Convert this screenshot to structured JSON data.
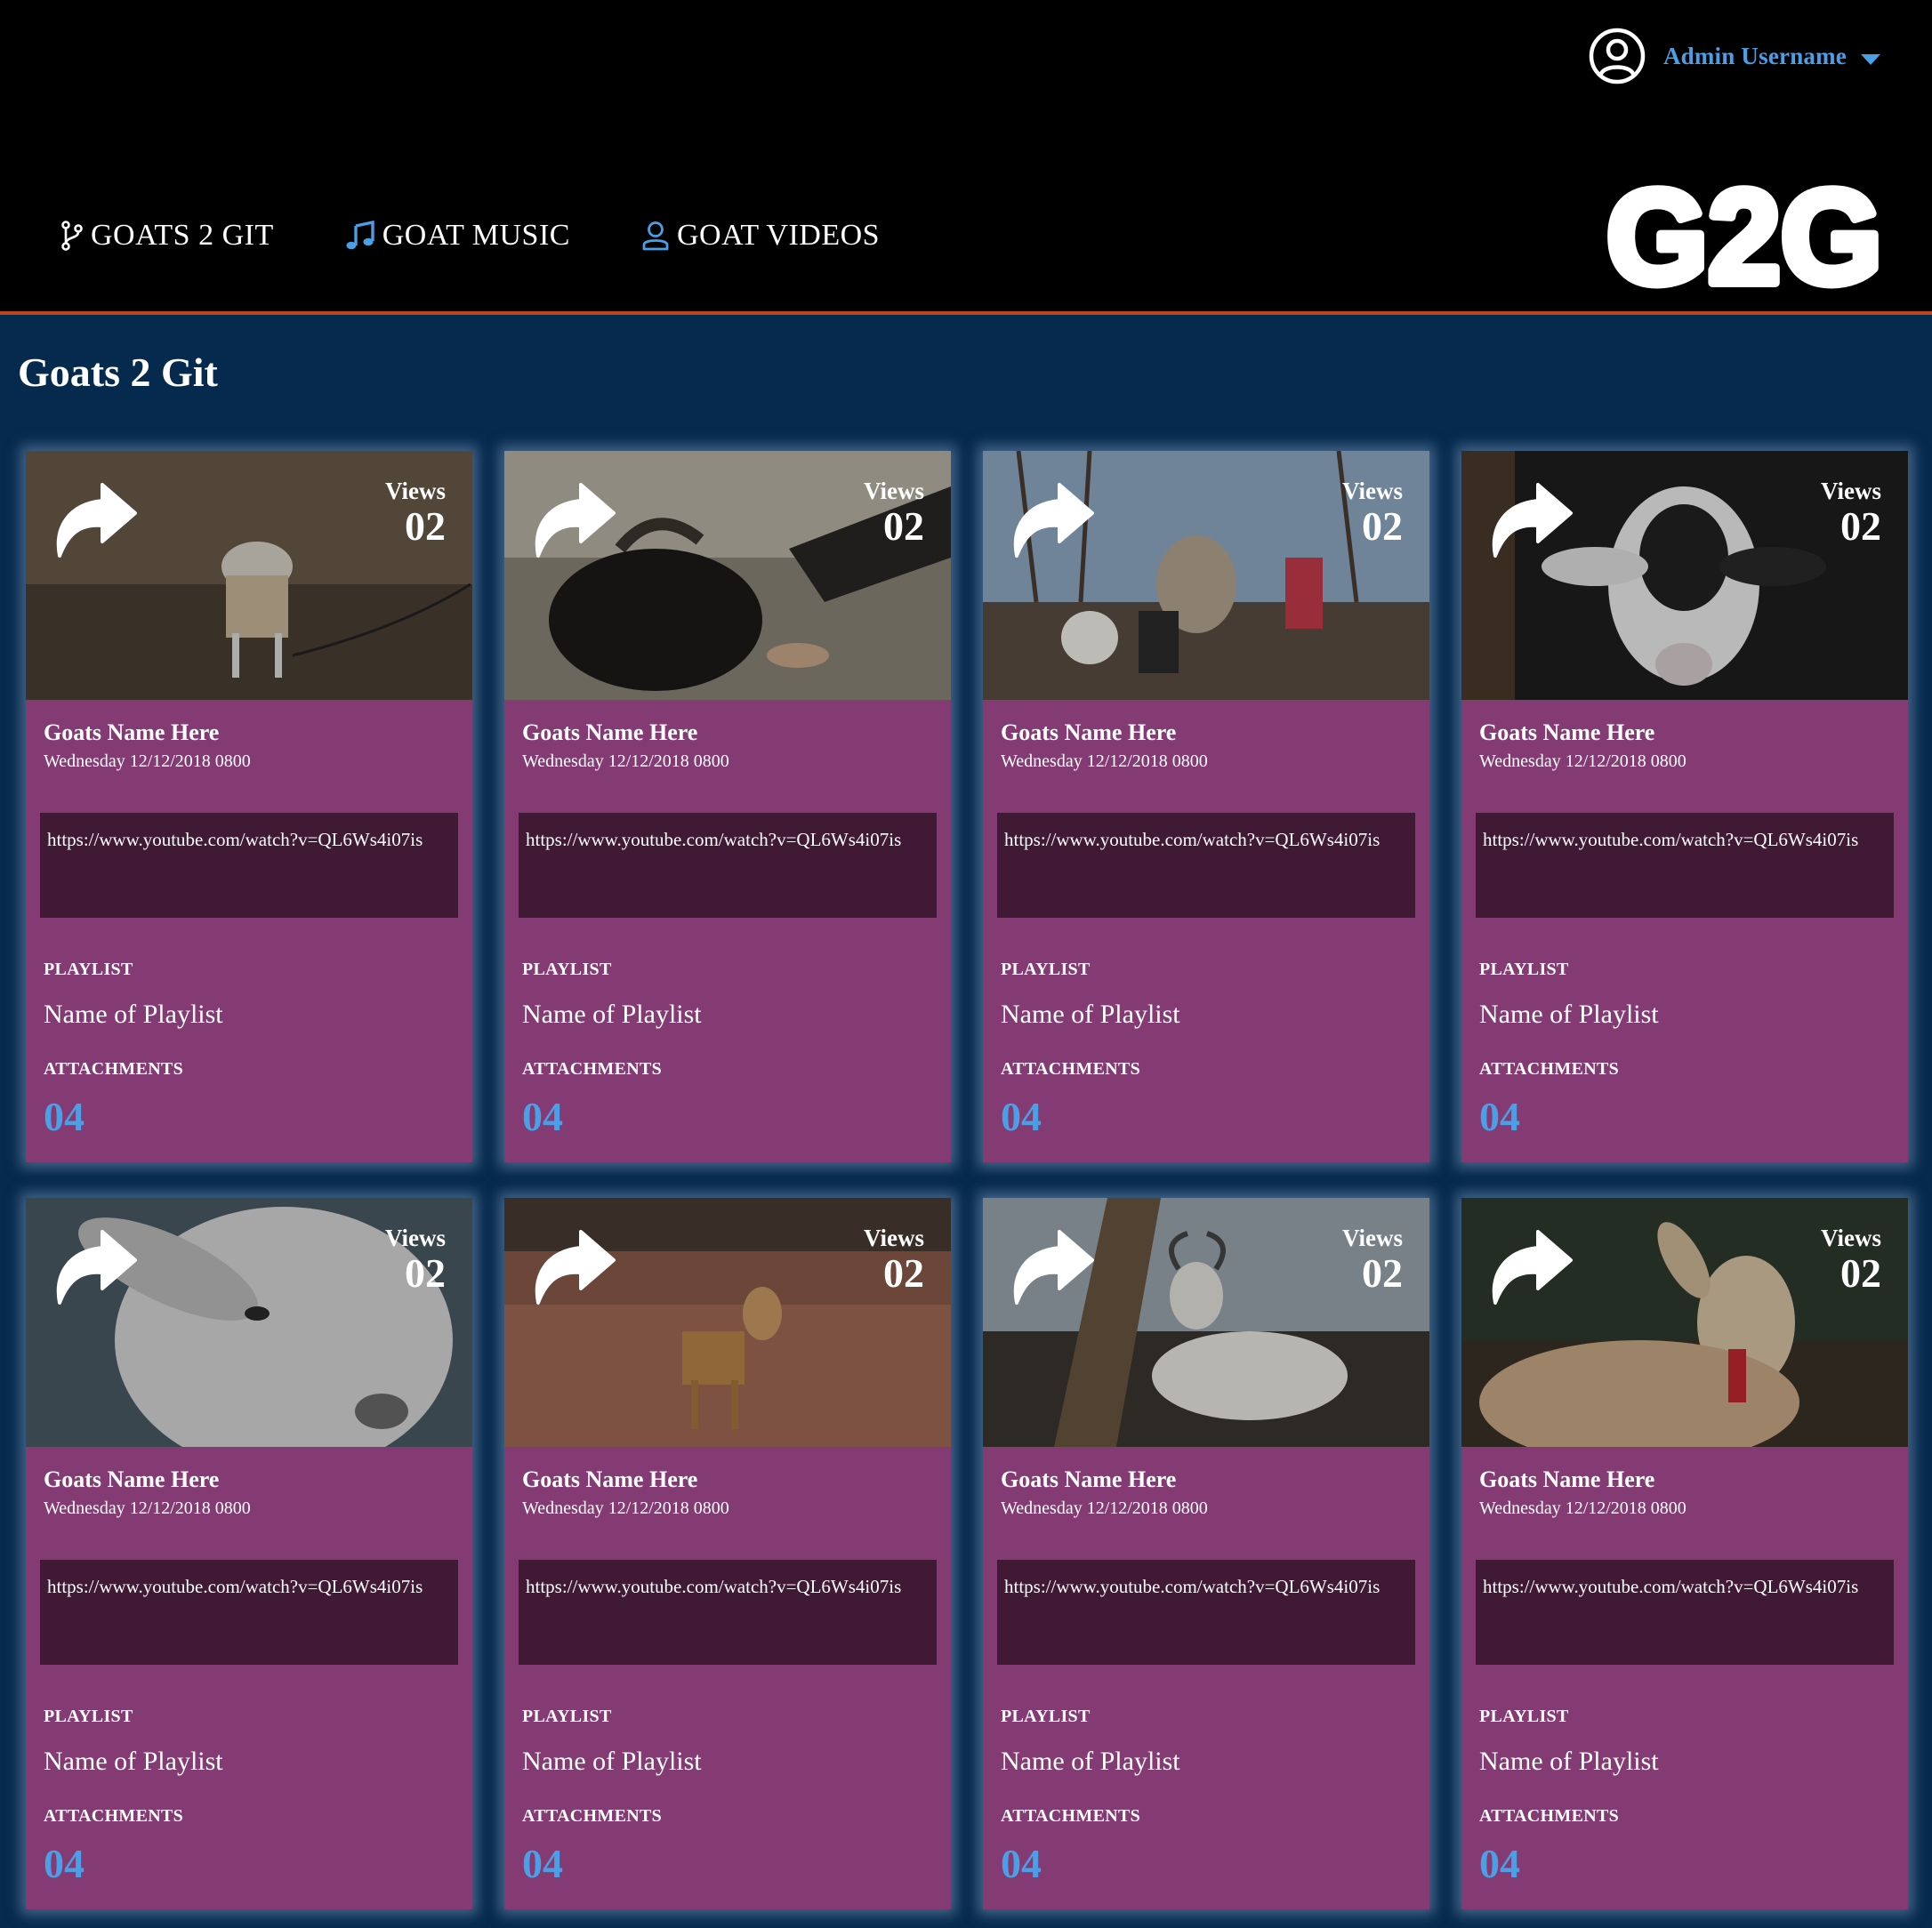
{
  "header": {
    "user": {
      "name": "Admin Username",
      "avatar_icon": "user-circle-icon",
      "menu_icon": "caret-down-icon"
    },
    "nav": [
      {
        "label": "GOATS 2 GIT",
        "icon": "git-branch-icon"
      },
      {
        "label": "GOAT MUSIC",
        "icon": "music-note-icon"
      },
      {
        "label": "GOAT VIDEOS",
        "icon": "user-outline-icon"
      }
    ],
    "logo_text": "G2G"
  },
  "page": {
    "title": "Goats 2 Git"
  },
  "colors": {
    "header_bg": "#000000",
    "page_bg": "#062a4d",
    "header_border": "#c0441f",
    "card_bg": "#843a73",
    "url_box_bg": "#401935",
    "accent_blue": "#4a9fe6"
  },
  "cards": [
    {
      "views_label": "Views",
      "views": "02",
      "name": "Goats Name Here",
      "date": "Wednesday 12/12/2018 0800",
      "url": "https://www.youtube.com/watch?v=QL6Ws4i07is",
      "playlist_label": "PLAYLIST",
      "playlist": "Name of Playlist",
      "attachments_label": "ATTACHMENTS",
      "attachments": "04",
      "share_icon": "share-arrow-icon"
    },
    {
      "views_label": "Views",
      "views": "02",
      "name": "Goats Name Here",
      "date": "Wednesday 12/12/2018 0800",
      "url": "https://www.youtube.com/watch?v=QL6Ws4i07is",
      "playlist_label": "PLAYLIST",
      "playlist": "Name of Playlist",
      "attachments_label": "ATTACHMENTS",
      "attachments": "04",
      "share_icon": "share-arrow-icon"
    },
    {
      "views_label": "Views",
      "views": "02",
      "name": "Goats Name Here",
      "date": "Wednesday 12/12/2018 0800",
      "url": "https://www.youtube.com/watch?v=QL6Ws4i07is",
      "playlist_label": "PLAYLIST",
      "playlist": "Name of Playlist",
      "attachments_label": "ATTACHMENTS",
      "attachments": "04",
      "share_icon": "share-arrow-icon"
    },
    {
      "views_label": "Views",
      "views": "02",
      "name": "Goats Name Here",
      "date": "Wednesday 12/12/2018 0800",
      "url": "https://www.youtube.com/watch?v=QL6Ws4i07is",
      "playlist_label": "PLAYLIST",
      "playlist": "Name of Playlist",
      "attachments_label": "ATTACHMENTS",
      "attachments": "04",
      "share_icon": "share-arrow-icon"
    },
    {
      "views_label": "Views",
      "views": "02",
      "name": "Goats Name Here",
      "date": "Wednesday 12/12/2018 0800",
      "url": "https://www.youtube.com/watch?v=QL6Ws4i07is",
      "playlist_label": "PLAYLIST",
      "playlist": "Name of Playlist",
      "attachments_label": "ATTACHMENTS",
      "attachments": "04",
      "share_icon": "share-arrow-icon"
    },
    {
      "views_label": "Views",
      "views": "02",
      "name": "Goats Name Here",
      "date": "Wednesday 12/12/2018 0800",
      "url": "https://www.youtube.com/watch?v=QL6Ws4i07is",
      "playlist_label": "PLAYLIST",
      "playlist": "Name of Playlist",
      "attachments_label": "ATTACHMENTS",
      "attachments": "04",
      "share_icon": "share-arrow-icon"
    },
    {
      "views_label": "Views",
      "views": "02",
      "name": "Goats Name Here",
      "date": "Wednesday 12/12/2018 0800",
      "url": "https://www.youtube.com/watch?v=QL6Ws4i07is",
      "playlist_label": "PLAYLIST",
      "playlist": "Name of Playlist",
      "attachments_label": "ATTACHMENTS",
      "attachments": "04",
      "share_icon": "share-arrow-icon"
    },
    {
      "views_label": "Views",
      "views": "02",
      "name": "Goats Name Here",
      "date": "Wednesday 12/12/2018 0800",
      "url": "https://www.youtube.com/watch?v=QL6Ws4i07is",
      "playlist_label": "PLAYLIST",
      "playlist": "Name of Playlist",
      "attachments_label": "ATTACHMENTS",
      "attachments": "04",
      "share_icon": "share-arrow-icon"
    }
  ]
}
